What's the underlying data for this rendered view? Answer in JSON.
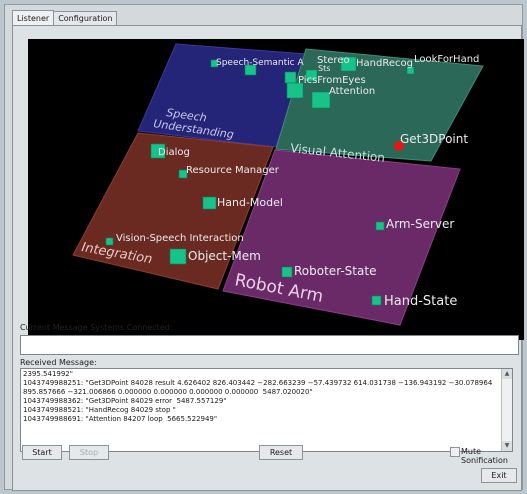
{
  "tabs": [
    {
      "label": "Listener",
      "active": true
    },
    {
      "label": "Configuration",
      "active": false
    }
  ],
  "scene": {
    "regions": [
      {
        "name": "speech",
        "label_lines": [
          "Speech",
          "Understanding"
        ],
        "color": "#26267a"
      },
      {
        "name": "visual",
        "label_lines": [
          "Visual Attention"
        ],
        "color": "#2d6b5a"
      },
      {
        "name": "integration",
        "label_lines": [
          "Integration"
        ],
        "color": "#6e2c22"
      },
      {
        "name": "robot",
        "label_lines": [
          "Robot Arm"
        ],
        "color": "#6e2b6b"
      }
    ],
    "nodes": [
      {
        "name": "Speech-Semantic",
        "label": "Speech-Semantic A",
        "color": "#18c38a"
      },
      {
        "name": "Stereo",
        "label": "Stereo",
        "color": "#18c38a"
      },
      {
        "name": "HandRecog",
        "label": "HandRecog",
        "color": "#18c38a"
      },
      {
        "name": "LookForHand",
        "label": "LookForHand",
        "color": "#18c38a"
      },
      {
        "name": "Sts",
        "label": "Sts",
        "color": "#18c38a"
      },
      {
        "name": "PicsFromEyes",
        "label": "PicsFromEyes",
        "color": "#18c38a"
      },
      {
        "name": "Attention",
        "label": "Attention",
        "color": "#18c38a"
      },
      {
        "name": "Get3DPoint",
        "label": "Get3DPoint",
        "color": "#e01818"
      },
      {
        "name": "Dialog",
        "label": "Dialog",
        "color": "#18c38a"
      },
      {
        "name": "Resource-Manager",
        "label": "Resource Manager",
        "color": "#18c38a"
      },
      {
        "name": "Hand-Model",
        "label": "Hand-Model",
        "color": "#18c38a"
      },
      {
        "name": "Vision-Speech-Interaction",
        "label": "Vision-Speech Interaction",
        "color": "#18c38a"
      },
      {
        "name": "Object-Mem",
        "label": "Object-Mem",
        "color": "#18c38a"
      },
      {
        "name": "Arm-Server",
        "label": "Arm-Server",
        "color": "#18c38a"
      },
      {
        "name": "Roboter-State",
        "label": "Roboter-State",
        "color": "#18c38a"
      },
      {
        "name": "Hand-State",
        "label": "Hand-State",
        "color": "#18c38a"
      }
    ]
  },
  "connected": {
    "label": "Current Message Systems Connected:",
    "value": ""
  },
  "received": {
    "label": "Received Message:",
    "lines": [
      "2395.541992\"",
      "1043749988251: \"Get3DPoint 84028 result 4.626402 826.403442 −282.663239 −57.439732 614.031738 −136.943192 −30.078964 895.857666 −321.006866 0.000000 0.000000 0.000000 0.000000  5487.020020\"",
      "1043749988362: \"Get3DPoint 84029 error  5487.557129\"",
      "1043749988521: \"HandRecog 84029 stop \"",
      "1043749988691: \"Attention 84207 loop  5665.522949\""
    ]
  },
  "buttons": {
    "start": "Start",
    "stop": "Stop",
    "reset": "Reset",
    "exit": "Exit"
  },
  "mute": {
    "label": "Mute Sonification",
    "checked": false
  }
}
